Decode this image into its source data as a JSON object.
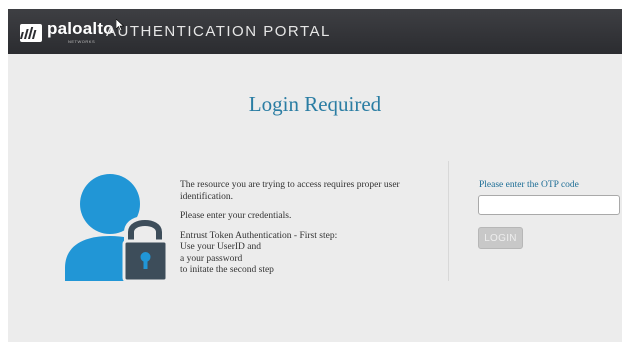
{
  "header": {
    "logo_text": "paloalto",
    "logo_subtext": "NETWORKS",
    "portal_title": "AUTHENTICATION PORTAL"
  },
  "main": {
    "heading": "Login Required",
    "info": {
      "line1": "The resource you are trying to access requires proper user identification.",
      "line2": "Please enter your credentials.",
      "line3": "Entrust Token Authentication - First step:",
      "line4": "Use your UserID and",
      "line5": "a your password",
      "line6": "to initate the second step"
    },
    "otp_label": "Please enter the OTP code",
    "otp_value": "",
    "login_label": "LOGIN"
  },
  "colors": {
    "header_bg": "#2f3034",
    "heading": "#2a7da3",
    "user_icon": "#2196d6",
    "lock": "#3d4d5a",
    "otp_label": "#1d6e96"
  },
  "icons": [
    "paloalto-logo-icon",
    "mouse-cursor-icon",
    "user-lock-icon"
  ]
}
